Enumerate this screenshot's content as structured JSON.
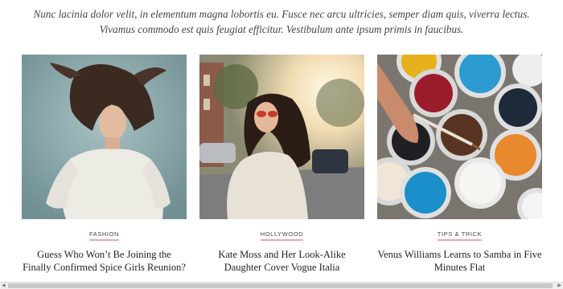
{
  "intro": {
    "text": "Nunc lacinia dolor velit, in elementum magna lobortis eu. Fusce nec arcu ultricies, semper diam quis, viverra lectus. Vivamus commodo est quis feugiat efficitur. Vestibulum ante ipsum primis in faucibus."
  },
  "posts": [
    {
      "category": "FASHION",
      "title": "Guess Who Won’t Be Joining the Finally Confirmed Spice Girls Reunion?",
      "image_icon": "woman-hair-flip-photo"
    },
    {
      "category": "HOLLYWOOD",
      "title": "Kate Moss and Her Look-Alike Daughter Cover Vogue Italia",
      "image_icon": "woman-street-sunset-photo"
    },
    {
      "category": "TIPS & TRICK",
      "title": "Venus Williams Learns to Samba in Five Minutes Flat",
      "image_icon": "paint-cans-photo"
    }
  ],
  "scrollbar": {
    "left_arrow_icon": "arrow-left-icon",
    "right_arrow_icon": "arrow-right-icon"
  },
  "colors": {
    "category_underline": "#f2a6a6",
    "photo1_bg": "#8aa8ab",
    "photo2_bg": "#d9c7a4",
    "photo3_bg": "#6f6a63"
  }
}
